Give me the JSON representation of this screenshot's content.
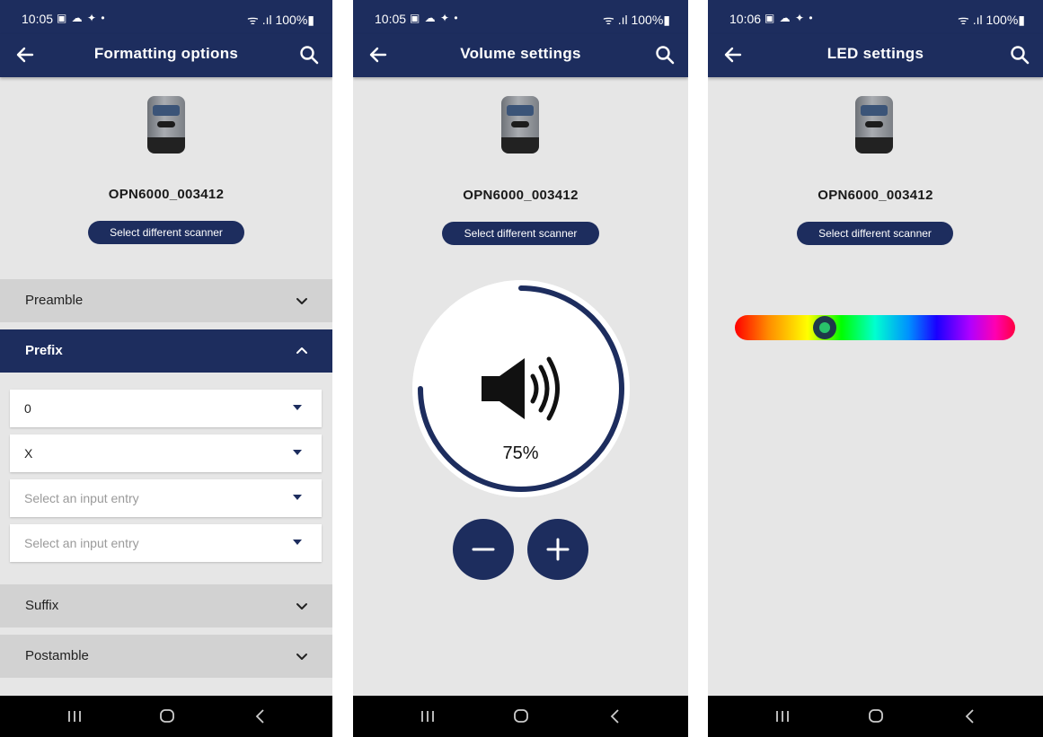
{
  "screens": [
    {
      "status": {
        "time": "10:05",
        "icons": "▣ ☁ ✦ •",
        "battery": "ᯤ .ıl 100%▮"
      },
      "title": "Formatting options",
      "device_name": "OPN6000_003412",
      "select_button": "Select different scanner",
      "sections": {
        "preamble": "Preamble",
        "prefix": "Prefix",
        "suffix": "Suffix",
        "postamble": "Postamble"
      },
      "prefix_entries": [
        {
          "value": "0"
        },
        {
          "value": "X"
        },
        {
          "placeholder": "Select an input entry"
        },
        {
          "placeholder": "Select an input entry"
        }
      ]
    },
    {
      "status": {
        "time": "10:05",
        "icons": "▣ ☁ ✦ •",
        "battery": "ᯤ .ıl 100%▮"
      },
      "title": "Volume settings",
      "device_name": "OPN6000_003412",
      "select_button": "Select different scanner",
      "volume": {
        "percent_label": "75%",
        "level": 0.75
      }
    },
    {
      "status": {
        "time": "10:06",
        "icons": "▣ ☁ ✦ •",
        "battery": "ᯤ .ıl 100%▮"
      },
      "title": "LED settings",
      "device_name": "OPN6000_003412",
      "select_button": "Select different scanner",
      "led": {
        "selected_hue_fraction": 0.32,
        "selected_color": "#29c36a"
      }
    }
  ],
  "colors": {
    "primary": "#1d2d5e",
    "background": "#e6e6e6",
    "section_closed": "#d2d2d2"
  }
}
